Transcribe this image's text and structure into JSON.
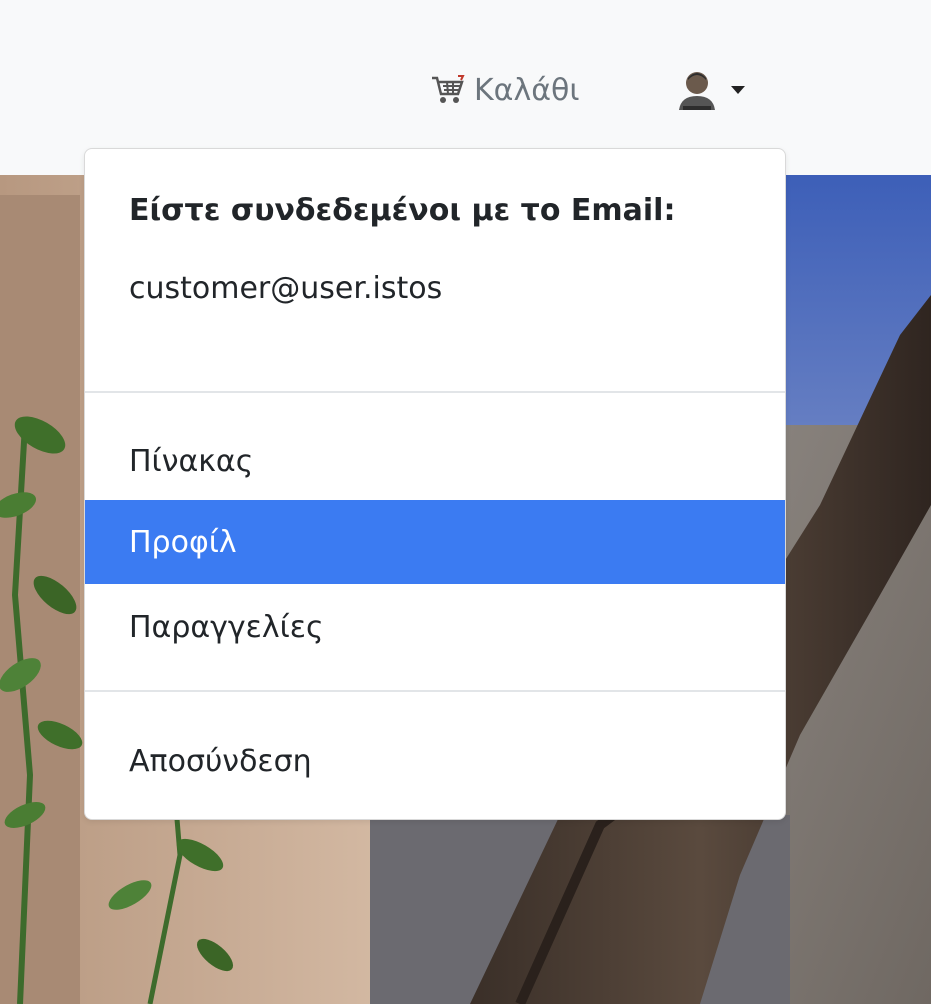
{
  "navbar": {
    "cart_label": "Καλάθι",
    "cart_icon": "shopping-cart-icon",
    "user_icon": "user-avatar-icon",
    "caret_icon": "caret-down-icon"
  },
  "dropdown": {
    "title": "Είστε συνδεδεμένοι με το Email:",
    "email": "customer@user.istos",
    "items": [
      {
        "label": "Πίνακας",
        "active": false
      },
      {
        "label": "Προφίλ",
        "active": true
      },
      {
        "label": "Παραγγελίες",
        "active": false
      }
    ],
    "logout_label": "Αποσύνδεση"
  },
  "colors": {
    "active_bg": "#3b7bf2",
    "active_text": "#ffffff",
    "navbar_bg": "#f8f9fa",
    "text": "#212529",
    "muted": "#6c757d"
  }
}
